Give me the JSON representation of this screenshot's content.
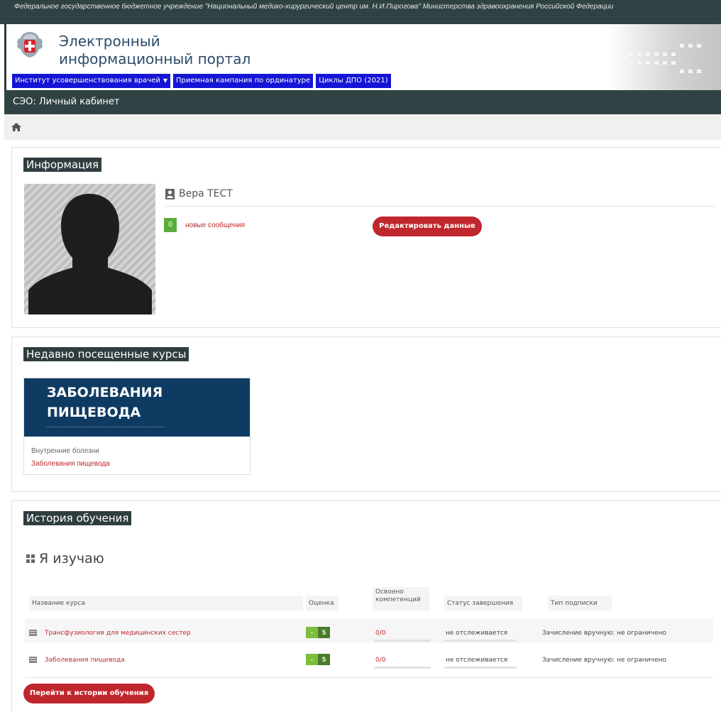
{
  "topbar": {
    "org_text": "Федеральное государственное бюджетное учреждение \"Национальный медико-хирургический центр им. Н.И.Пирогова\" Министерства здравоохранения Российской Федерации"
  },
  "header": {
    "title": "Электронный информационный портал",
    "nav": [
      {
        "label": "Институт усовершенствования врачей",
        "has_dropdown": true
      },
      {
        "label": "Приемная кампания по ординатуре",
        "has_dropdown": false
      },
      {
        "label": "Циклы ДПО (2021)",
        "has_dropdown": false
      }
    ]
  },
  "subbar": {
    "title": "СЭО: Личный кабинет"
  },
  "info": {
    "section_title": "Информация",
    "user_name": "Вера ТЕСТ",
    "message_count": "0",
    "messages_label": "новые сообщения",
    "edit_button": "Редактировать данные"
  },
  "recent": {
    "section_title": "Недавно посещенные курсы",
    "tile_title": "ЗАБОЛЕВАНИЯ ПИЩЕВОДА",
    "category": "Внутренние болезни",
    "course_link": "Заболевания пищевода"
  },
  "history": {
    "section_title": "История обучения",
    "heading": "Я изучаю",
    "columns": {
      "course": "Название курса",
      "grade": "Оценка",
      "competencies": "Освоено компетенций",
      "status": "Статус завершения",
      "subscription": "Тип подписки"
    },
    "rows": [
      {
        "course": "Трансфузиология для медицинских сестер",
        "grade_left": "-",
        "grade_right": "5",
        "competencies": "0/0",
        "status": "не отслеживается",
        "subscription": "Зачисление вручную: не ограничено"
      },
      {
        "course": "Заболевания пищевода",
        "grade_left": "-",
        "grade_right": "5",
        "competencies": "0/0",
        "status": "не отслеживается",
        "subscription": "Зачисление вручную: не ограничено"
      }
    ],
    "history_button": "Перейти к истории обучения"
  },
  "colors": {
    "accent_red": "#c0272d",
    "nav_blue": "#1515d6",
    "dark_bar": "#2f3d3f",
    "tile_navy": "#0f3b62",
    "badge_green": "#5cac3c"
  }
}
